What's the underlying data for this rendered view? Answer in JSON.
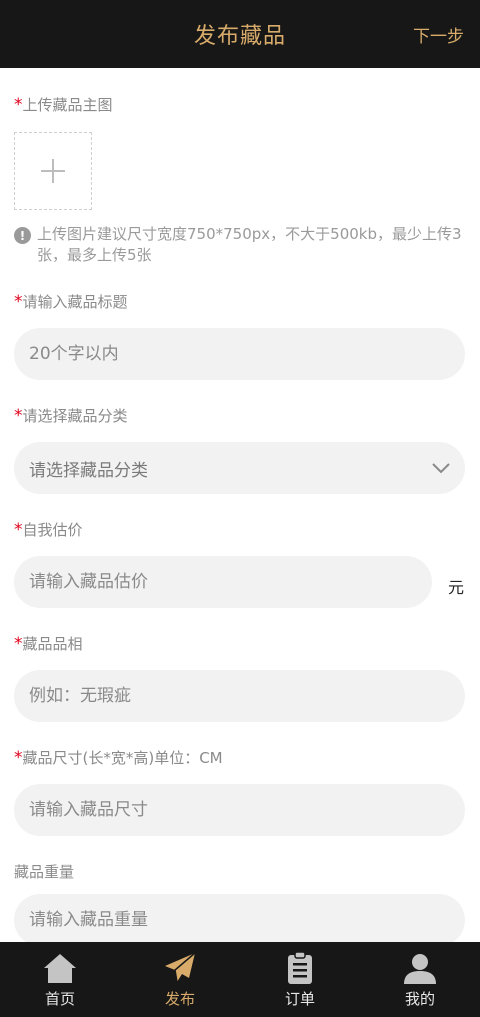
{
  "header": {
    "title": "发布藏品",
    "next_label": "下一步"
  },
  "form": {
    "main_image": {
      "required_mark": "*",
      "label": "上传藏品主图"
    },
    "upload_hint": "上传图片建议尺寸宽度750*750px，不大于500kb，最少上传3张，最多上传5张",
    "title_field": {
      "required_mark": "*",
      "label": "请输入藏品标题",
      "placeholder": "20个字以内"
    },
    "category_field": {
      "required_mark": "*",
      "label": "请选择藏品分类",
      "placeholder": "请选择藏品分类"
    },
    "price_field": {
      "required_mark": "*",
      "label": "自我估价",
      "placeholder": "请输入藏品估价",
      "unit": "元"
    },
    "condition_field": {
      "required_mark": "*",
      "label": "藏品品相",
      "placeholder": "例如：无瑕疵"
    },
    "size_field": {
      "required_mark": "*",
      "label": "藏品尺寸(长*宽*高)单位：CM",
      "placeholder": "请输入藏品尺寸"
    },
    "weight_field": {
      "label": "藏品重量",
      "placeholder": "请输入藏品重量"
    }
  },
  "tabbar": {
    "items": [
      {
        "label": "首页",
        "icon": "home-icon"
      },
      {
        "label": "发布",
        "icon": "paper-plane-icon",
        "active": true
      },
      {
        "label": "订单",
        "icon": "clipboard-icon"
      },
      {
        "label": "我的",
        "icon": "user-icon"
      }
    ]
  },
  "colors": {
    "accent": "#d8ab6a",
    "header_bg": "#171717",
    "required": "#e0001b",
    "field_bg": "#f2f2f2"
  }
}
